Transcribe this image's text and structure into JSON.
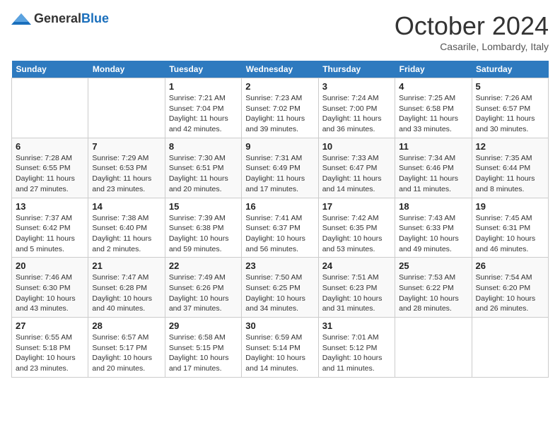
{
  "logo": {
    "general": "General",
    "blue": "Blue"
  },
  "header": {
    "month": "October 2024",
    "location": "Casarile, Lombardy, Italy"
  },
  "days_of_week": [
    "Sunday",
    "Monday",
    "Tuesday",
    "Wednesday",
    "Thursday",
    "Friday",
    "Saturday"
  ],
  "weeks": [
    [
      {
        "day": "",
        "sunrise": "",
        "sunset": "",
        "daylight": ""
      },
      {
        "day": "",
        "sunrise": "",
        "sunset": "",
        "daylight": ""
      },
      {
        "day": "1",
        "sunrise": "Sunrise: 7:21 AM",
        "sunset": "Sunset: 7:04 PM",
        "daylight": "Daylight: 11 hours and 42 minutes."
      },
      {
        "day": "2",
        "sunrise": "Sunrise: 7:23 AM",
        "sunset": "Sunset: 7:02 PM",
        "daylight": "Daylight: 11 hours and 39 minutes."
      },
      {
        "day": "3",
        "sunrise": "Sunrise: 7:24 AM",
        "sunset": "Sunset: 7:00 PM",
        "daylight": "Daylight: 11 hours and 36 minutes."
      },
      {
        "day": "4",
        "sunrise": "Sunrise: 7:25 AM",
        "sunset": "Sunset: 6:58 PM",
        "daylight": "Daylight: 11 hours and 33 minutes."
      },
      {
        "day": "5",
        "sunrise": "Sunrise: 7:26 AM",
        "sunset": "Sunset: 6:57 PM",
        "daylight": "Daylight: 11 hours and 30 minutes."
      }
    ],
    [
      {
        "day": "6",
        "sunrise": "Sunrise: 7:28 AM",
        "sunset": "Sunset: 6:55 PM",
        "daylight": "Daylight: 11 hours and 27 minutes."
      },
      {
        "day": "7",
        "sunrise": "Sunrise: 7:29 AM",
        "sunset": "Sunset: 6:53 PM",
        "daylight": "Daylight: 11 hours and 23 minutes."
      },
      {
        "day": "8",
        "sunrise": "Sunrise: 7:30 AM",
        "sunset": "Sunset: 6:51 PM",
        "daylight": "Daylight: 11 hours and 20 minutes."
      },
      {
        "day": "9",
        "sunrise": "Sunrise: 7:31 AM",
        "sunset": "Sunset: 6:49 PM",
        "daylight": "Daylight: 11 hours and 17 minutes."
      },
      {
        "day": "10",
        "sunrise": "Sunrise: 7:33 AM",
        "sunset": "Sunset: 6:47 PM",
        "daylight": "Daylight: 11 hours and 14 minutes."
      },
      {
        "day": "11",
        "sunrise": "Sunrise: 7:34 AM",
        "sunset": "Sunset: 6:46 PM",
        "daylight": "Daylight: 11 hours and 11 minutes."
      },
      {
        "day": "12",
        "sunrise": "Sunrise: 7:35 AM",
        "sunset": "Sunset: 6:44 PM",
        "daylight": "Daylight: 11 hours and 8 minutes."
      }
    ],
    [
      {
        "day": "13",
        "sunrise": "Sunrise: 7:37 AM",
        "sunset": "Sunset: 6:42 PM",
        "daylight": "Daylight: 11 hours and 5 minutes."
      },
      {
        "day": "14",
        "sunrise": "Sunrise: 7:38 AM",
        "sunset": "Sunset: 6:40 PM",
        "daylight": "Daylight: 11 hours and 2 minutes."
      },
      {
        "day": "15",
        "sunrise": "Sunrise: 7:39 AM",
        "sunset": "Sunset: 6:38 PM",
        "daylight": "Daylight: 10 hours and 59 minutes."
      },
      {
        "day": "16",
        "sunrise": "Sunrise: 7:41 AM",
        "sunset": "Sunset: 6:37 PM",
        "daylight": "Daylight: 10 hours and 56 minutes."
      },
      {
        "day": "17",
        "sunrise": "Sunrise: 7:42 AM",
        "sunset": "Sunset: 6:35 PM",
        "daylight": "Daylight: 10 hours and 53 minutes."
      },
      {
        "day": "18",
        "sunrise": "Sunrise: 7:43 AM",
        "sunset": "Sunset: 6:33 PM",
        "daylight": "Daylight: 10 hours and 49 minutes."
      },
      {
        "day": "19",
        "sunrise": "Sunrise: 7:45 AM",
        "sunset": "Sunset: 6:31 PM",
        "daylight": "Daylight: 10 hours and 46 minutes."
      }
    ],
    [
      {
        "day": "20",
        "sunrise": "Sunrise: 7:46 AM",
        "sunset": "Sunset: 6:30 PM",
        "daylight": "Daylight: 10 hours and 43 minutes."
      },
      {
        "day": "21",
        "sunrise": "Sunrise: 7:47 AM",
        "sunset": "Sunset: 6:28 PM",
        "daylight": "Daylight: 10 hours and 40 minutes."
      },
      {
        "day": "22",
        "sunrise": "Sunrise: 7:49 AM",
        "sunset": "Sunset: 6:26 PM",
        "daylight": "Daylight: 10 hours and 37 minutes."
      },
      {
        "day": "23",
        "sunrise": "Sunrise: 7:50 AM",
        "sunset": "Sunset: 6:25 PM",
        "daylight": "Daylight: 10 hours and 34 minutes."
      },
      {
        "day": "24",
        "sunrise": "Sunrise: 7:51 AM",
        "sunset": "Sunset: 6:23 PM",
        "daylight": "Daylight: 10 hours and 31 minutes."
      },
      {
        "day": "25",
        "sunrise": "Sunrise: 7:53 AM",
        "sunset": "Sunset: 6:22 PM",
        "daylight": "Daylight: 10 hours and 28 minutes."
      },
      {
        "day": "26",
        "sunrise": "Sunrise: 7:54 AM",
        "sunset": "Sunset: 6:20 PM",
        "daylight": "Daylight: 10 hours and 26 minutes."
      }
    ],
    [
      {
        "day": "27",
        "sunrise": "Sunrise: 6:55 AM",
        "sunset": "Sunset: 5:18 PM",
        "daylight": "Daylight: 10 hours and 23 minutes."
      },
      {
        "day": "28",
        "sunrise": "Sunrise: 6:57 AM",
        "sunset": "Sunset: 5:17 PM",
        "daylight": "Daylight: 10 hours and 20 minutes."
      },
      {
        "day": "29",
        "sunrise": "Sunrise: 6:58 AM",
        "sunset": "Sunset: 5:15 PM",
        "daylight": "Daylight: 10 hours and 17 minutes."
      },
      {
        "day": "30",
        "sunrise": "Sunrise: 6:59 AM",
        "sunset": "Sunset: 5:14 PM",
        "daylight": "Daylight: 10 hours and 14 minutes."
      },
      {
        "day": "31",
        "sunrise": "Sunrise: 7:01 AM",
        "sunset": "Sunset: 5:12 PM",
        "daylight": "Daylight: 10 hours and 11 minutes."
      },
      {
        "day": "",
        "sunrise": "",
        "sunset": "",
        "daylight": ""
      },
      {
        "day": "",
        "sunrise": "",
        "sunset": "",
        "daylight": ""
      }
    ]
  ]
}
